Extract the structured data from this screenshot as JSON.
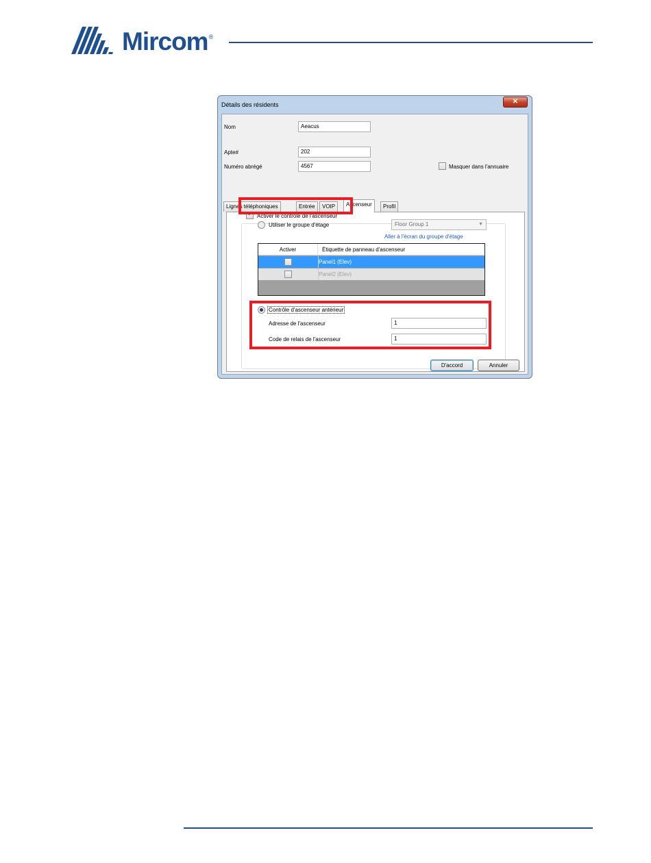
{
  "brand": {
    "logo_text": "Mircom",
    "trademark": "®",
    "color": "#1d4f91"
  },
  "dialog": {
    "title": "Détails des résidents",
    "close_label": "✕",
    "fields": {
      "nom_label": "Nom",
      "nom_value": "Aeacus",
      "apt_label": "Apte#",
      "apt_value": "202",
      "numero_label": "Numéro abrégé",
      "numero_value": "4567",
      "masquer_label": "Masquer dans l'annuaire"
    },
    "tabs": [
      {
        "label": "Lignes téléphoniques"
      },
      {
        "label": "Entrée"
      },
      {
        "label": "VOIP"
      },
      {
        "label": "Ascenseur"
      },
      {
        "label": "Profil"
      }
    ],
    "active_tab": "Ascenseur",
    "elevator": {
      "enable_label": "Activer le contrôle de l'ascenseur",
      "enable_checked": true,
      "floor_group_label": "Utiliser le groupe d'étage",
      "floor_group_value": "Floor Group 1",
      "floor_group_link": "Aller à l'écran du groupe d'étage",
      "table": {
        "headers": [
          "Activer",
          "Étiquette de panneau d'ascenseur"
        ],
        "rows": [
          {
            "label": "Panel1 (Elev)"
          },
          {
            "label": "Panel2 (Elev)"
          }
        ]
      },
      "legacy_label": "Contrôle d'ascenseur antérieur",
      "legacy_selected": true,
      "address_label": "Adresse de l'ascenseur",
      "address_value": "1",
      "relay_label": "Code de relais de l'ascenseur",
      "relay_value": "1"
    },
    "buttons": {
      "ok": "D'accord",
      "cancel": "Annuler"
    }
  },
  "colors": {
    "highlight": "#ed1c24",
    "selection": "#3399ff",
    "link": "#1c5dbd"
  }
}
